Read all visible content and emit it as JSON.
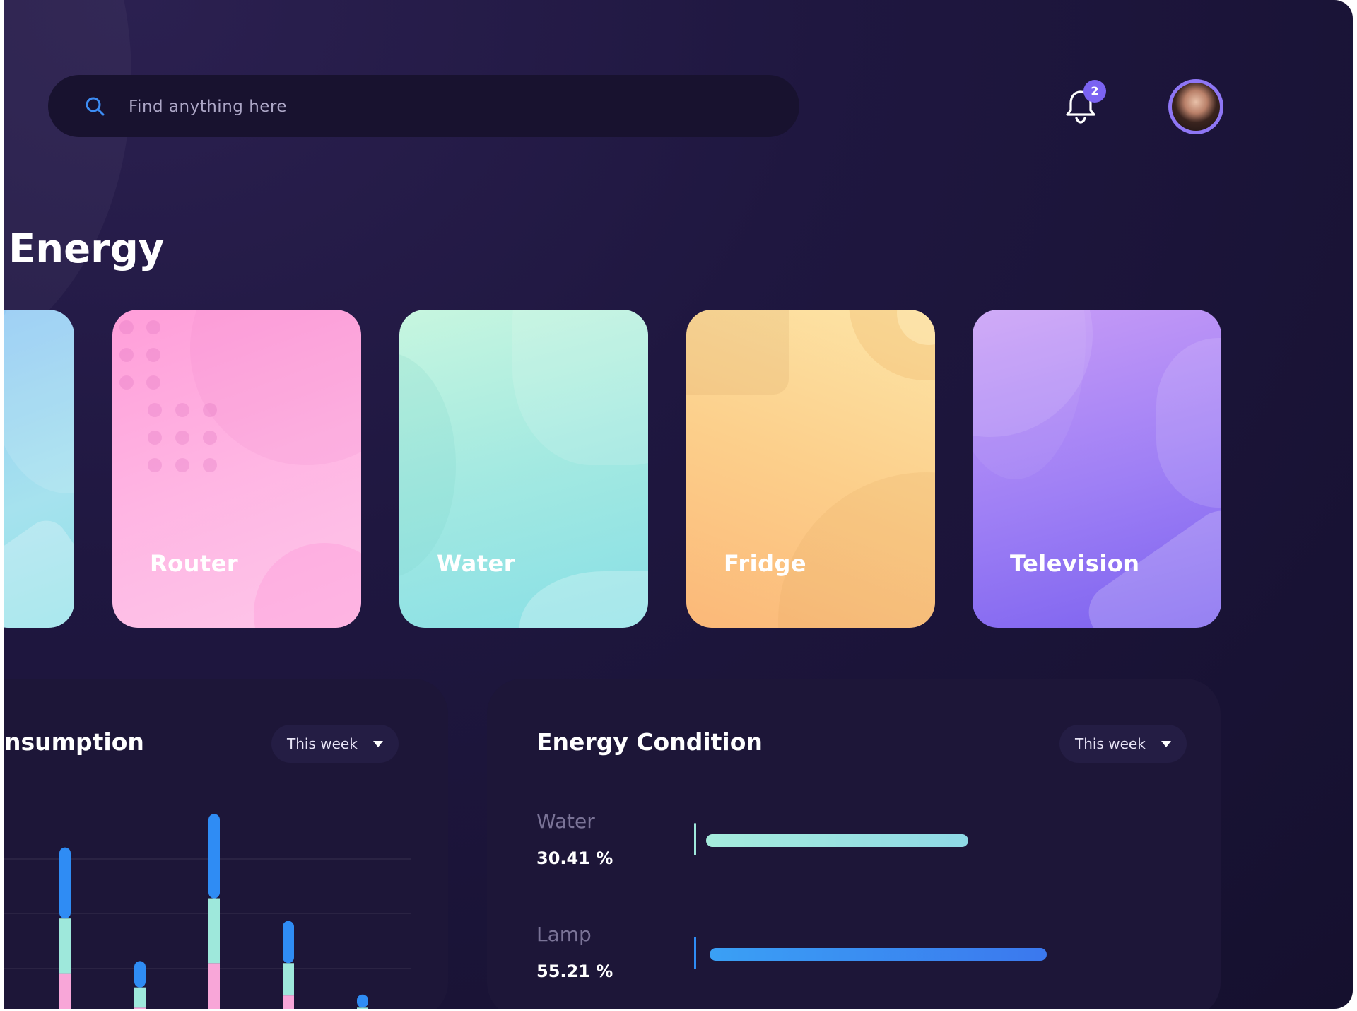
{
  "search": {
    "placeholder": "Find anything here"
  },
  "notifications": {
    "count": "2"
  },
  "page": {
    "title": "Energy"
  },
  "devices": [
    {
      "name": ""
    },
    {
      "name": "Router"
    },
    {
      "name": "Water"
    },
    {
      "name": "Fridge"
    },
    {
      "name": "Television"
    }
  ],
  "consumption": {
    "title": "nsumption",
    "period": "This week"
  },
  "condition": {
    "title": "Energy Condition",
    "period": "This week",
    "items": [
      {
        "name": "Water",
        "value": "30.41 %",
        "level": 0.3041,
        "color": "#9ee8db"
      },
      {
        "name": "Lamp",
        "value": "55.21 %",
        "level": 0.5521,
        "color": "#2f8cf4"
      }
    ]
  },
  "colors": {
    "accent": "#7b63f2",
    "blue": "#2f8cf4",
    "mint": "#9ee8db",
    "pink": "#f8a6d8"
  },
  "chart_data": {
    "type": "bar",
    "title": "nsumption",
    "categories": [
      "",
      "",
      "",
      "",
      ""
    ],
    "series": [
      {
        "values": [
          27,
          10,
          32,
          16,
          5
        ]
      },
      {
        "values": [
          27,
          10,
          32,
          16,
          5
        ]
      },
      {
        "values": [
          27,
          10,
          32,
          16,
          5
        ]
      }
    ],
    "grid": true,
    "xlabel": "",
    "ylabel": ""
  }
}
